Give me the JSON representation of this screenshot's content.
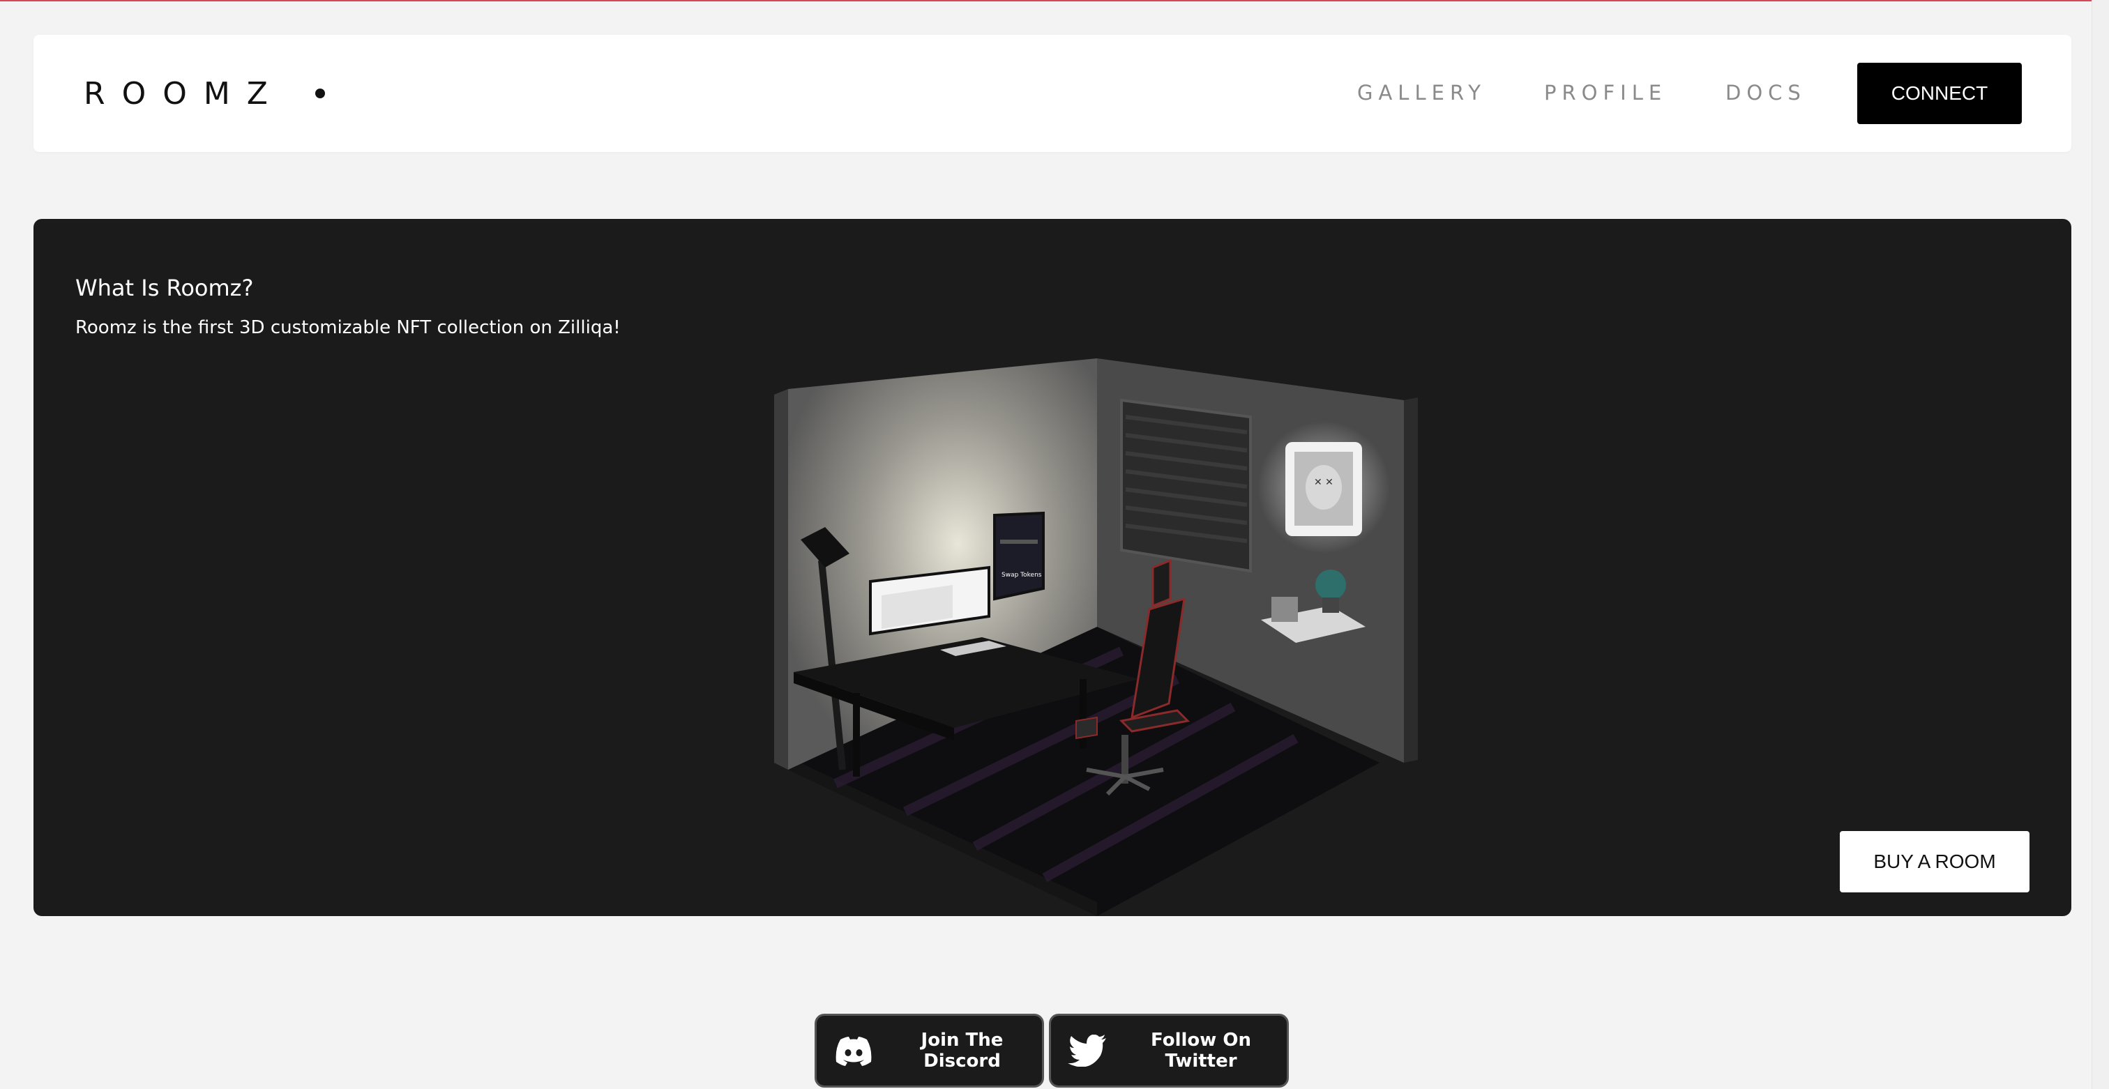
{
  "header": {
    "logo": "ROOMZ",
    "nav": {
      "gallery": "GALLERY",
      "profile": "PROFILE",
      "docs": "DOCS"
    },
    "connect_label": "CONNECT"
  },
  "hero": {
    "title": "What Is Roomz?",
    "description": "Roomz is the first 3D customizable NFT collection on Zilliqa!",
    "buy_label": "BUY A ROOM"
  },
  "social": {
    "discord_label": "Join The Discord",
    "twitter_label": "Follow On Twitter"
  },
  "icons": {
    "logo_dot": "dot-icon",
    "discord": "discord-icon",
    "twitter": "twitter-icon"
  },
  "colors": {
    "page_bg": "#f3f3f3",
    "panel_bg": "#1b1b1b",
    "accent_line": "#d4485a",
    "button_dark": "#000000",
    "button_light": "#ffffff"
  }
}
